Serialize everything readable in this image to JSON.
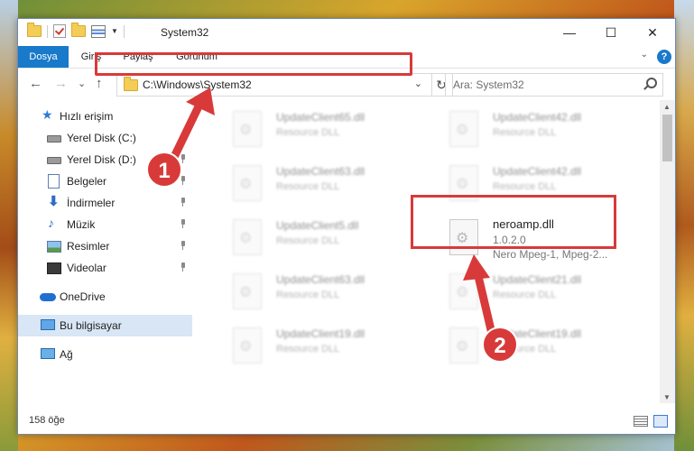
{
  "window": {
    "title": "System32"
  },
  "ribbon": {
    "tabs": [
      {
        "label": "Dosya",
        "active": true
      },
      {
        "label": "Giriş",
        "active": false
      },
      {
        "label": "Paylaş",
        "active": false
      },
      {
        "label": "Görünüm",
        "active": false
      }
    ],
    "help_label": "?"
  },
  "window_controls": {
    "minimize": "—",
    "maximize": "☐",
    "close": "✕"
  },
  "navigation": {
    "back": "←",
    "forward": "→",
    "recent": "⌄",
    "up": "↑",
    "address": "C:\\Windows\\System32",
    "refresh": "↻",
    "search_placeholder": "Ara: System32"
  },
  "sidebar": {
    "items": [
      {
        "label": "Hızlı erişim",
        "icon": "star-icon",
        "pinned": false,
        "selected": false
      },
      {
        "label": "Yerel Disk (C:)",
        "icon": "drive-icon",
        "pinned": true,
        "selected": false
      },
      {
        "label": "Yerel Disk (D:)",
        "icon": "drive-icon",
        "pinned": true,
        "selected": false
      },
      {
        "label": "Belgeler",
        "icon": "documents-icon",
        "pinned": true,
        "selected": false
      },
      {
        "label": "İndirmeler",
        "icon": "downloads-icon",
        "pinned": true,
        "selected": false
      },
      {
        "label": "Müzik",
        "icon": "music-icon",
        "pinned": true,
        "selected": false
      },
      {
        "label": "Resimler",
        "icon": "pictures-icon",
        "pinned": true,
        "selected": false
      },
      {
        "label": "Videolar",
        "icon": "videos-icon",
        "pinned": true,
        "selected": false
      },
      {
        "label": "OneDrive",
        "icon": "onedrive-icon",
        "pinned": false,
        "selected": false
      },
      {
        "label": "Bu bilgisayar",
        "icon": "computer-icon",
        "pinned": false,
        "selected": true
      },
      {
        "label": "Ağ",
        "icon": "network-icon",
        "pinned": false,
        "selected": false
      }
    ]
  },
  "files": [
    {
      "name": "UpdateClient65.dll",
      "type": "Resource DLL",
      "blurred": true
    },
    {
      "name": "UpdateClient42.dll",
      "type": "Resource DLL",
      "blurred": true
    },
    {
      "name": "UpdateClient63.dll",
      "type": "Resource DLL",
      "blurred": true
    },
    {
      "name": "UpdateClient42.dll",
      "type": "Resource DLL",
      "blurred": true
    },
    {
      "name": "UpdateClient5.dll",
      "type": "Resource DLL",
      "blurred": true
    },
    {
      "name": "neroamp.dll",
      "type": "1.0.2.0",
      "extra": "Nero Mpeg-1, Mpeg-2...",
      "blurred": false
    },
    {
      "name": "UpdateClient63.dll",
      "type": "Resource DLL",
      "blurred": true
    },
    {
      "name": "UpdateClient21.dll",
      "type": "Resource DLL",
      "blurred": true
    },
    {
      "name": "UpdateClient19.dll",
      "type": "Resource DLL",
      "blurred": true
    },
    {
      "name": "UpdateClient19.dll",
      "type": "Resource DLL",
      "blurred": true
    }
  ],
  "status": {
    "item_count": "158 öğe"
  },
  "annotations": {
    "step1_label": "1",
    "step2_label": "2",
    "color": "#d83a3a"
  }
}
